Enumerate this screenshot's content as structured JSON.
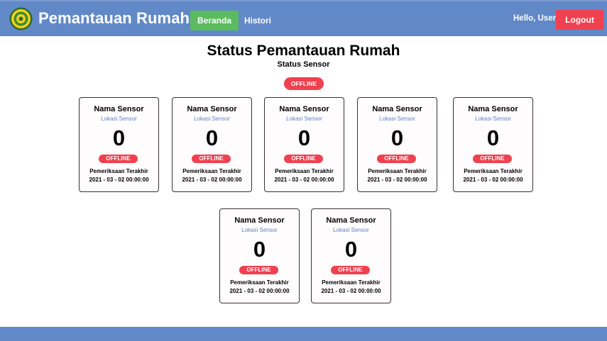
{
  "header": {
    "brand": "Pemantauan Rumah",
    "nav": {
      "home": "Beranda",
      "history": "Histori"
    },
    "greeting": "Hello, User",
    "logout": "Logout",
    "colors": {
      "navbar": "#6189c7",
      "home_button": "#5bbb5f",
      "logout_button": "#ef4150"
    }
  },
  "main": {
    "title": "Status Pemantauan Rumah",
    "subtitle": "Status Sensor",
    "status": "OFFLINE",
    "status_color": "#ef4150"
  },
  "sensors": [
    {
      "name": "Nama Sensor",
      "location": "Lokasi Sensor",
      "value": "0",
      "status": "OFFLINE",
      "check_label": "Pemeriksaan Terakhir",
      "check_time": "2021 - 03 - 02 00:00:00"
    },
    {
      "name": "Nama Sensor",
      "location": "Lokasi Sensor",
      "value": "0",
      "status": "OFFLINE",
      "check_label": "Pemeriksaan Terakhir",
      "check_time": "2021 - 03 - 02 00:00:00"
    },
    {
      "name": "Nama Sensor",
      "location": "Lokasi Sensor",
      "value": "0",
      "status": "OFFLINE",
      "check_label": "Pemeriksaan Terakhir",
      "check_time": "2021 - 03 - 02 00:00:00"
    },
    {
      "name": "Nama Sensor",
      "location": "Lokasi Sensor",
      "value": "0",
      "status": "OFFLINE",
      "check_label": "Pemeriksaan Terakhir",
      "check_time": "2021 - 03 - 02 00:00:00"
    },
    {
      "name": "Nama Sensor",
      "location": "Lokasi Sensor",
      "value": "0",
      "status": "OFFLINE",
      "check_label": "Pemeriksaan Terakhir",
      "check_time": "2021 - 03 - 02 00:00:00"
    },
    {
      "name": "Nama Sensor",
      "location": "Lokasi Sensor",
      "value": "0",
      "status": "OFFLINE",
      "check_label": "Pemeriksaan Terakhir",
      "check_time": "2021 - 03 - 02 00:00:00"
    },
    {
      "name": "Nama Sensor",
      "location": "Lokasi Sensor",
      "value": "0",
      "status": "OFFLINE",
      "check_label": "Pemeriksaan Terakhir",
      "check_time": "2021 - 03 - 02 00:00:00"
    }
  ]
}
